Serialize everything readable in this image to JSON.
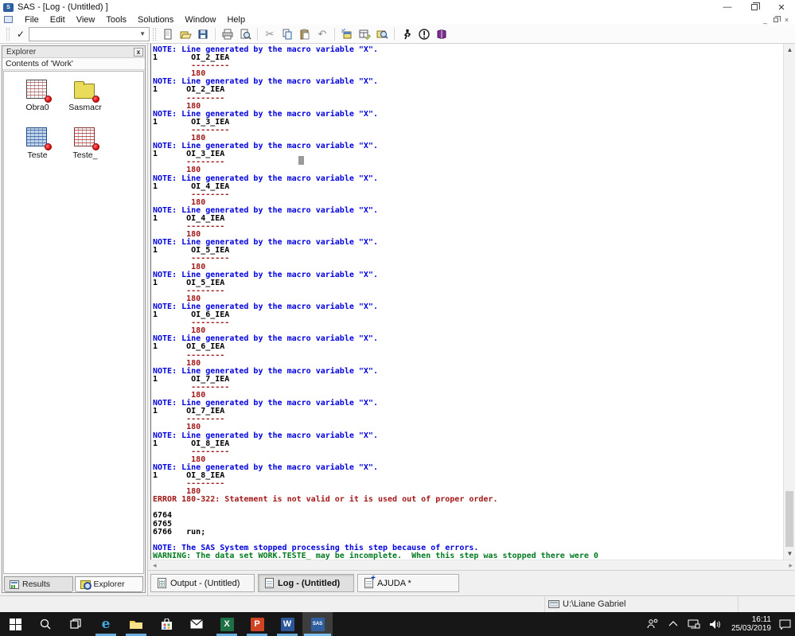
{
  "window": {
    "title": "SAS - [Log - (Untitled) ]"
  },
  "menu": {
    "items": [
      "File",
      "Edit",
      "View",
      "Tools",
      "Solutions",
      "Window",
      "Help"
    ]
  },
  "toolbar": {
    "command_value": "",
    "icons": [
      "new-icon",
      "open-icon",
      "save-icon",
      "print-icon",
      "print-preview-icon",
      "cut-icon",
      "copy-icon",
      "paste-icon",
      "undo-icon",
      "new-library-icon",
      "programs-icon",
      "find-icon",
      "submit-icon",
      "break-icon",
      "help-icon"
    ]
  },
  "explorer": {
    "title": "Explorer",
    "header": "Contents of 'Work'",
    "items": [
      {
        "label": "Obra0",
        "kind": "table-white"
      },
      {
        "label": "Sasmacr",
        "kind": "folder"
      },
      {
        "label": "Teste",
        "kind": "table-blue"
      },
      {
        "label": "Teste_",
        "kind": "table-red"
      }
    ],
    "tabs": [
      {
        "label": "Results",
        "active": false
      },
      {
        "label": "Explorer",
        "active": true
      }
    ]
  },
  "log": {
    "lines": [
      {
        "t": "note",
        "s": "NOTE: Line generated by the macro variable \"X\"."
      },
      {
        "t": "code",
        "s": "1       OI_2_IEA"
      },
      {
        "t": "mark",
        "s": "        --------"
      },
      {
        "t": "mark",
        "s": "        180"
      },
      {
        "t": "note",
        "s": "NOTE: Line generated by the macro variable \"X\"."
      },
      {
        "t": "code",
        "s": "1      OI_2_IEA"
      },
      {
        "t": "mark",
        "s": "       --------"
      },
      {
        "t": "mark",
        "s": "       180"
      },
      {
        "t": "note",
        "s": "NOTE: Line generated by the macro variable \"X\"."
      },
      {
        "t": "code",
        "s": "1       OI_3_IEA"
      },
      {
        "t": "mark",
        "s": "        --------"
      },
      {
        "t": "mark",
        "s": "        180"
      },
      {
        "t": "note",
        "s": "NOTE: Line generated by the macro variable \"X\"."
      },
      {
        "t": "code",
        "s": "1      OI_3_IEA"
      },
      {
        "t": "mark",
        "s": "       --------"
      },
      {
        "t": "mark",
        "s": "       180"
      },
      {
        "t": "note",
        "s": "NOTE: Line generated by the macro variable \"X\"."
      },
      {
        "t": "code",
        "s": "1       OI_4_IEA"
      },
      {
        "t": "mark",
        "s": "        --------"
      },
      {
        "t": "mark",
        "s": "        180"
      },
      {
        "t": "note",
        "s": "NOTE: Line generated by the macro variable \"X\"."
      },
      {
        "t": "code",
        "s": "1      OI_4_IEA"
      },
      {
        "t": "mark",
        "s": "       --------"
      },
      {
        "t": "mark",
        "s": "       180"
      },
      {
        "t": "note",
        "s": "NOTE: Line generated by the macro variable \"X\"."
      },
      {
        "t": "code",
        "s": "1       OI_5_IEA"
      },
      {
        "t": "mark",
        "s": "        --------"
      },
      {
        "t": "mark",
        "s": "        180"
      },
      {
        "t": "note",
        "s": "NOTE: Line generated by the macro variable \"X\"."
      },
      {
        "t": "code",
        "s": "1      OI_5_IEA"
      },
      {
        "t": "mark",
        "s": "       --------"
      },
      {
        "t": "mark",
        "s": "       180"
      },
      {
        "t": "note",
        "s": "NOTE: Line generated by the macro variable \"X\"."
      },
      {
        "t": "code",
        "s": "1       OI_6_IEA"
      },
      {
        "t": "mark",
        "s": "        --------"
      },
      {
        "t": "mark",
        "s": "        180"
      },
      {
        "t": "note",
        "s": "NOTE: Line generated by the macro variable \"X\"."
      },
      {
        "t": "code",
        "s": "1      OI_6_IEA"
      },
      {
        "t": "mark",
        "s": "       --------"
      },
      {
        "t": "mark",
        "s": "       180"
      },
      {
        "t": "note",
        "s": "NOTE: Line generated by the macro variable \"X\"."
      },
      {
        "t": "code",
        "s": "1       OI_7_IEA"
      },
      {
        "t": "mark",
        "s": "        --------"
      },
      {
        "t": "mark",
        "s": "        180"
      },
      {
        "t": "note",
        "s": "NOTE: Line generated by the macro variable \"X\"."
      },
      {
        "t": "code",
        "s": "1      OI_7_IEA"
      },
      {
        "t": "mark",
        "s": "       --------"
      },
      {
        "t": "mark",
        "s": "       180"
      },
      {
        "t": "note",
        "s": "NOTE: Line generated by the macro variable \"X\"."
      },
      {
        "t": "code",
        "s": "1       OI_8_IEA"
      },
      {
        "t": "mark",
        "s": "        --------"
      },
      {
        "t": "mark",
        "s": "        180"
      },
      {
        "t": "note",
        "s": "NOTE: Line generated by the macro variable \"X\"."
      },
      {
        "t": "code",
        "s": "1      OI_8_IEA"
      },
      {
        "t": "mark",
        "s": "       --------"
      },
      {
        "t": "mark",
        "s": "       180"
      },
      {
        "t": "error",
        "s": "ERROR 180-322: Statement is not valid or it is used out of proper order."
      },
      {
        "t": "blank",
        "s": ""
      },
      {
        "t": "code",
        "s": "6764"
      },
      {
        "t": "code",
        "s": "6765"
      },
      {
        "t": "code",
        "s": "6766   run;"
      },
      {
        "t": "blank",
        "s": ""
      },
      {
        "t": "note",
        "s": "NOTE: The SAS System stopped processing this step because of errors."
      },
      {
        "t": "warning",
        "s": "WARNING: The data set WORK.TESTE_ may be incomplete.  When this step was stopped there were 0"
      }
    ]
  },
  "window_bar": {
    "tabs": [
      {
        "label": "Output - (Untitled)",
        "icon": "output-page-icon",
        "active": false
      },
      {
        "label": "Log - (Untitled)",
        "icon": "log-page-icon",
        "active": true
      },
      {
        "label": "AJUDA *",
        "icon": "help-page-icon",
        "active": false
      }
    ]
  },
  "statusbar": {
    "path": "U:\\Liane Gabriel"
  },
  "taskbar": {
    "time": "16:11",
    "date": "25/03/2019",
    "apps": [
      "start",
      "search",
      "task-view",
      "edge",
      "file-explorer",
      "store",
      "mail",
      "excel",
      "powerpoint",
      "word",
      "sas"
    ]
  },
  "colors": {
    "note_blue": "#0000de",
    "error_red": "#a21818",
    "warning_green": "#007a1f",
    "accent_underline": "#67aede"
  }
}
